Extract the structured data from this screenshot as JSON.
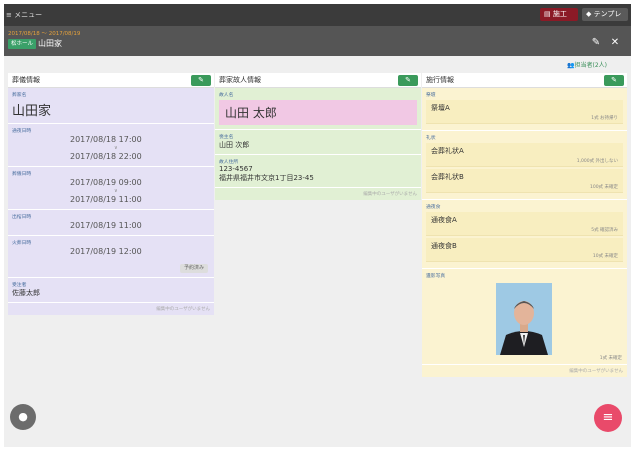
{
  "topbar": {
    "menu": "≡ メニュー",
    "btn1": "施工",
    "btn2": "テンプレ"
  },
  "subbar": {
    "dates": "2017/08/18 〜 2017/08/19",
    "tag": "松ホール",
    "family": "山田家"
  },
  "members": "担当者(2人)",
  "col1": {
    "header": "葬儀情報",
    "family_label": "葬家名",
    "family": "山田家",
    "wake_label": "通夜日時",
    "wake_start": "2017/08/18 17:00",
    "wake_end": "2017/08/18 22:00",
    "funeral_label": "葬儀日時",
    "funeral_start": "2017/08/19 09:00",
    "funeral_end": "2017/08/19 11:00",
    "departure_label": "出棺日時",
    "departure": "2017/08/19 11:00",
    "cremation_label": "火葬日時",
    "cremation": "2017/08/19 12:00",
    "reserved": "予約済み",
    "recipient_label": "受注者",
    "recipient": "佐藤太郎",
    "note": "編集中のユーザがいません"
  },
  "col2": {
    "header": "葬家故人情報",
    "deceased_label": "故人名",
    "deceased": "山田 太郎",
    "chief_label": "喪主名",
    "chief": "山田 次郎",
    "address_label": "故人住所",
    "postal": "123-4567",
    "address": "福井県福井市文京1丁目23-45",
    "note": "編集中のユーザがいません"
  },
  "col3": {
    "header": "施行情報",
    "altar_label": "祭壇",
    "altar": "祭壇A",
    "altar_meta": "1式 お持帰り",
    "gift_label": "礼状",
    "gift1": "会葬礼状A",
    "gift1_meta": "1,000式 外出しない",
    "gift2": "会葬礼状B",
    "gift2_meta": "100式 未確定",
    "food_label": "通夜食",
    "food1": "通夜食A",
    "food1_meta": "5式 確認済み",
    "food2": "通夜食B",
    "food2_meta": "10式 未確定",
    "photo_label": "遺影写真",
    "photo_meta": "1式 未確定",
    "note": "編集中のユーザがいません"
  },
  "colors": {
    "accent_green": "#3a9a5b",
    "fab_pink": "#e94a6a",
    "topbar": "#3b3b3b"
  }
}
